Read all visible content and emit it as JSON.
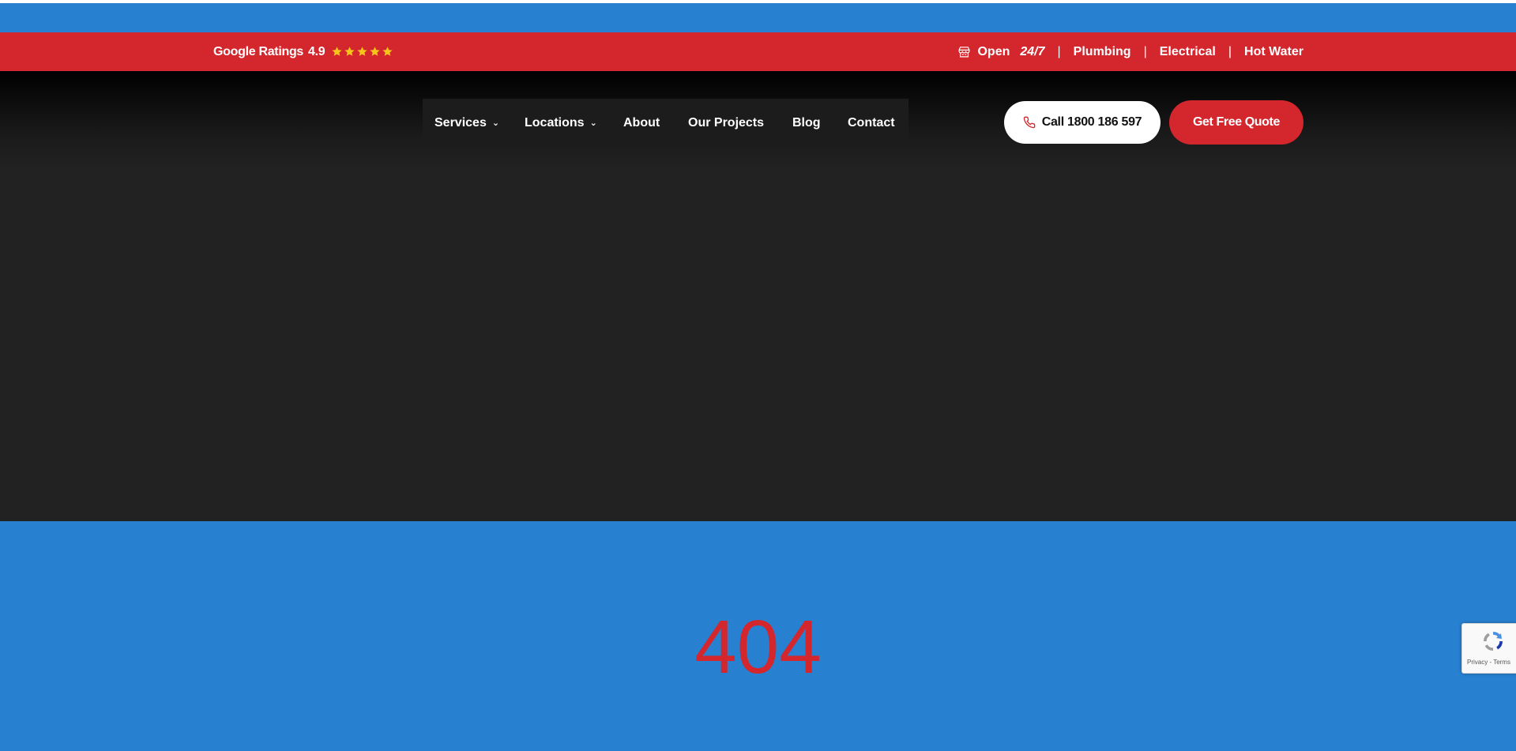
{
  "colors": {
    "brand_red": "#d4262d",
    "brand_blue": "#2780d0",
    "dark": "#222222",
    "star_yellow": "#f5c518"
  },
  "topbar": {
    "ratings_label": "Google Ratings",
    "rating_value": "4.9",
    "stars": 5,
    "open_label": "Open",
    "open_hours": "24/7",
    "links": [
      "Plumbing",
      "Electrical",
      "Hot Water"
    ]
  },
  "nav": {
    "items": [
      {
        "label": "Services",
        "has_dropdown": true
      },
      {
        "label": "Locations",
        "has_dropdown": true
      },
      {
        "label": "About",
        "has_dropdown": false
      },
      {
        "label": "Our Projects",
        "has_dropdown": false
      },
      {
        "label": "Blog",
        "has_dropdown": false
      },
      {
        "label": "Contact",
        "has_dropdown": false
      }
    ]
  },
  "cta": {
    "call_label": "Call 1800 186 597",
    "quote_label": "Get Free Quote"
  },
  "error": {
    "code": "404"
  },
  "recaptcha": {
    "terms": "Privacy - Terms"
  }
}
